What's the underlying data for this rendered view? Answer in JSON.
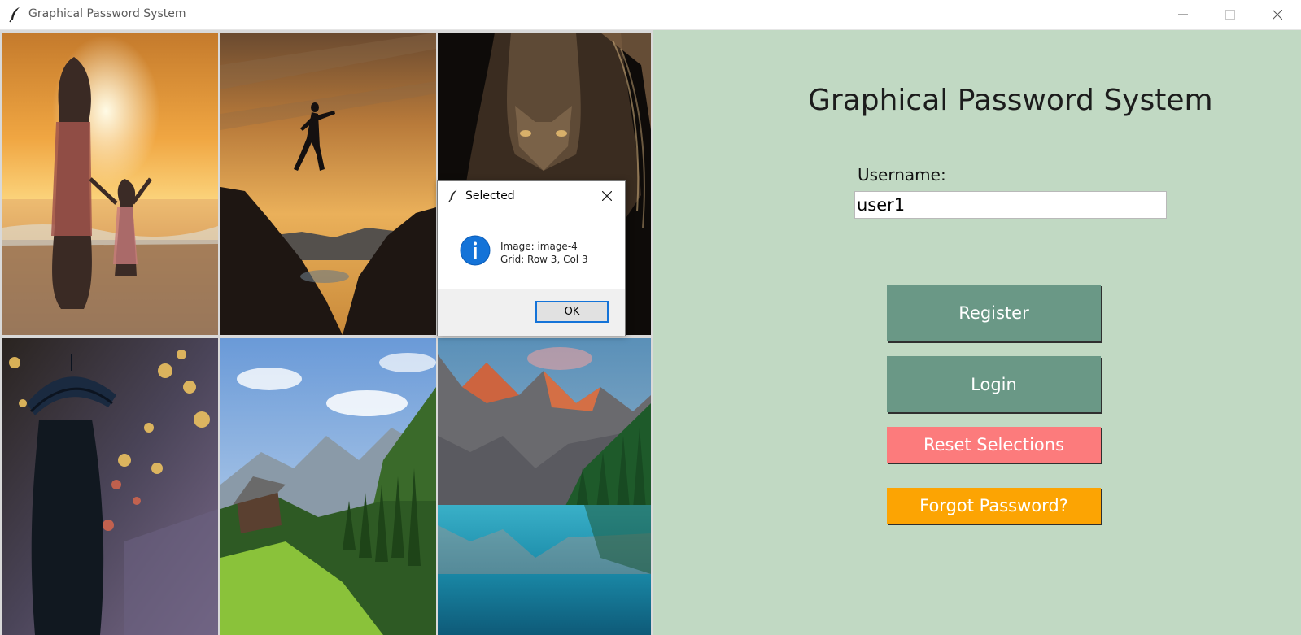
{
  "window": {
    "title": "Graphical Password System",
    "icons": {
      "app": "feather-icon",
      "minimize": "minimize-icon",
      "maximize": "maximize-icon",
      "close": "close-icon"
    }
  },
  "image_grid": {
    "rows": 2,
    "cols": 3,
    "tiles": [
      {
        "scene": "mother and child on beach at sunset"
      },
      {
        "scene": "person jumping over cliffs at sunset"
      },
      {
        "scene": "lion face in dark"
      },
      {
        "scene": "person with umbrella in rainy city lights"
      },
      {
        "scene": "cabin in green mountain valley"
      },
      {
        "scene": "mountain lake with turquoise water"
      }
    ]
  },
  "panel": {
    "heading": "Graphical Password System",
    "username_label": "Username:",
    "username_value": "user1",
    "buttons": {
      "register": "Register",
      "login": "Login",
      "reset": "Reset Selections",
      "forgot": "Forgot Password?"
    }
  },
  "dialog": {
    "title": "Selected",
    "line1": "Image: image-4",
    "line2": "Grid: Row 3, Col 3",
    "ok_label": "OK",
    "icon": "info-icon"
  },
  "colors": {
    "panel_bg": "#c1d9c3",
    "register_login_btn": "#6a9886",
    "reset_btn": "#fc7b7c",
    "forgot_btn": "#fca403",
    "info_blue": "#1473d8"
  }
}
